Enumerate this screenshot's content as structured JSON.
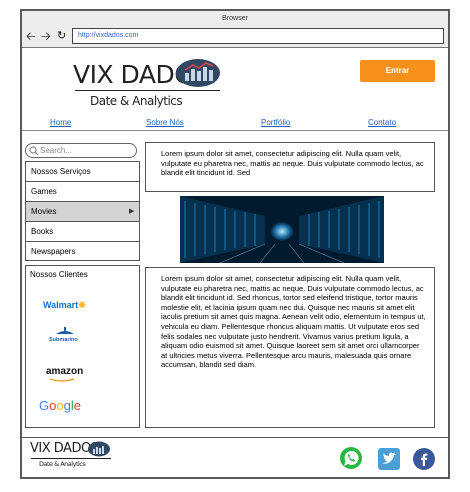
{
  "browser": {
    "title": "Browser",
    "url": "http://vixdados.com",
    "back_icon": "arrow-left-icon",
    "forward_icon": "arrow-right-icon",
    "reload_icon": "reload-icon"
  },
  "header": {
    "logo_title": "VIX DADOS",
    "logo_subtitle": "Date & Analytics",
    "login_label": "Entrar",
    "accent_color": "#f8901c"
  },
  "nav": {
    "links": [
      "Home",
      "Sobre Nós",
      "Portfólio",
      "Contato"
    ]
  },
  "sidebar": {
    "search_placeholder": "Search...",
    "items": [
      "Nossos Serviços",
      "Games",
      "Movies",
      "Books",
      "Newspapers"
    ],
    "selected": "Movies",
    "clients_title": "Nossos Clientes",
    "clients": [
      "Walmart",
      "Submarino",
      "amazon",
      "Google"
    ]
  },
  "main": {
    "intro_text": "Lorem ipsum dolor sit amet, consectetur adipiscing elit. Nulla quam velit, vulputate eu pharetra nec, mattis ac neque. Duis vulputate commodo lectus, ac blandit elit tincidunt id. Sed",
    "body_text": "Lorem ipsum dolor sit amet, consectetur adipiscing elit. Nulla quam velit, vulputate eu pharetra nec, mattis ac neque. Duis vulputate commodo lectus, ac blandit elit tincidunt id. Sed rhoncus, tortor sed eleifend tristique, tortor mauris molestie elit, et lacinia ipsum quam nec dui. Quisque nec mauris sit amet elit iaculis pretium sit amet quis magna. Aenean velit odio, elementum in tempus ut, vehicula eu diam. Pellentesque rhoncus aliquam mattis. Ut vulputate eros sed felis sodales nec vulputate justo hendrerit. Vivamus varius pretium ligula, a aliquam odio euismod sit amet. Quisque laoreet sem sit amet orci ullamcorper at ultricies metus viverra. Pellentesque arcu mauris, malesuada quis ornare accumsan, blandit sed diam."
  },
  "footer": {
    "logo_title": "VIX DADOS",
    "logo_subtitle": "Date & Analytics",
    "social": [
      "whatsapp-icon",
      "twitter-icon",
      "facebook-icon"
    ]
  }
}
